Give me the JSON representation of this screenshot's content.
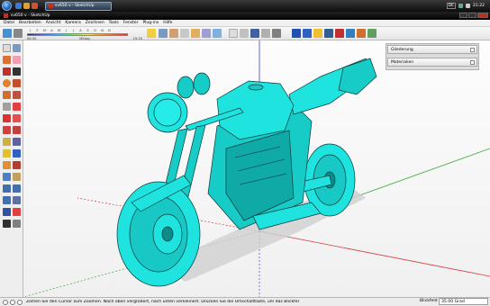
{
  "taskbar": {
    "task_label": "sv650 v - SketchUp",
    "lang": "DE",
    "clock": "21:22"
  },
  "window": {
    "title": "sv650 v - SketchUp"
  },
  "menu": [
    "Datei",
    "Bearbeiten",
    "Ansicht",
    "Kamera",
    "Zeichnen",
    "Tools",
    "Fenster",
    "Plug-ins",
    "Hilfe"
  ],
  "shadow_settings": {
    "months": [
      "J",
      "F",
      "M",
      "A",
      "M",
      "J",
      "J",
      "A",
      "S",
      "O",
      "N",
      "D"
    ],
    "time_start": "06:30",
    "time_mid": "Mittag",
    "time_end": "19:33"
  },
  "tray": {
    "panel_1": "Gliederung",
    "panel_2": "Materialien"
  },
  "status": {
    "message": "Ziehen Sie den Cursor zum Zoomen.  Nach oben vergrößert, nach unten verkleinert. Drücken Sie die Umschalttaste, um das Blickfel",
    "vcb_label": "Blickfeld",
    "vcb_value": "35.00 Grad"
  },
  "colors": {
    "model": "#1fe3df",
    "axis_red": "#d23a3a",
    "axis_green": "#3aa83a",
    "axis_blue": "#4040e0"
  }
}
